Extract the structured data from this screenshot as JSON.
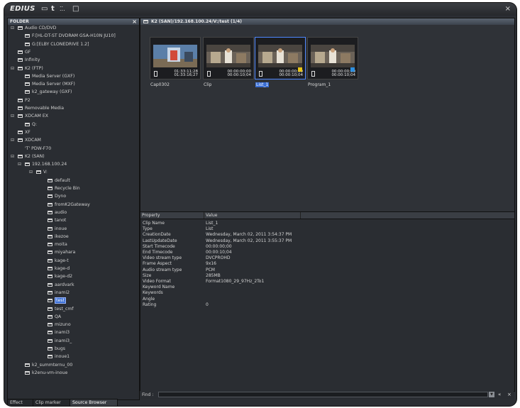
{
  "app": {
    "logo": "EDIUS"
  },
  "toolbar": {
    "icons": [
      "folder-icon",
      "text-icon",
      "grid-icon",
      "window-icon"
    ]
  },
  "folder_panel": {
    "title": "FOLDER",
    "close": "×",
    "tree": [
      {
        "label": "Audio CD/DVD",
        "level": 0,
        "exp": "−"
      },
      {
        "label": "F:[HL-DT-ST DVDRAM GSA-H10N JU10]",
        "level": 1,
        "exp": ""
      },
      {
        "label": "G:[ELBY CLONEDRIVE 1.2]",
        "level": 1,
        "exp": ""
      },
      {
        "label": "GF",
        "level": 0,
        "exp": ""
      },
      {
        "label": "Infinity",
        "level": 0,
        "exp": ""
      },
      {
        "label": "K2 (FTP)",
        "level": 0,
        "exp": "−"
      },
      {
        "label": "Media Server (GXF)",
        "level": 1,
        "exp": ""
      },
      {
        "label": "Media Server (MXF)",
        "level": 1,
        "exp": ""
      },
      {
        "label": "k2_gateway (GXF)",
        "level": 1,
        "exp": ""
      },
      {
        "label": "P2",
        "level": 0,
        "exp": ""
      },
      {
        "label": "Removable Media",
        "level": 0,
        "exp": ""
      },
      {
        "label": "XDCAM EX",
        "level": 0,
        "exp": "−"
      },
      {
        "label": "Q:",
        "level": 1,
        "exp": ""
      },
      {
        "label": "XF",
        "level": 0,
        "exp": ""
      },
      {
        "label": "XDCAM",
        "level": 0,
        "exp": "−"
      },
      {
        "label": "'T' PDW-F70",
        "level": 1,
        "exp": "",
        "plain": true
      },
      {
        "label": "K2 (SAN)",
        "level": 0,
        "exp": "−"
      },
      {
        "label": "192.168.100.24",
        "level": 1,
        "exp": "−"
      },
      {
        "label": "V:",
        "level": 2,
        "exp": "−"
      },
      {
        "label": "default",
        "level": 3,
        "exp": ""
      },
      {
        "label": "Recycle Bin",
        "level": 3,
        "exp": ""
      },
      {
        "label": "Dyno",
        "level": 3,
        "exp": ""
      },
      {
        "label": "fromK2Gateway",
        "level": 3,
        "exp": ""
      },
      {
        "label": "audio",
        "level": 3,
        "exp": ""
      },
      {
        "label": "tanot",
        "level": 3,
        "exp": ""
      },
      {
        "label": "inoue",
        "level": 3,
        "exp": ""
      },
      {
        "label": "ikezoe",
        "level": 3,
        "exp": ""
      },
      {
        "label": "moita",
        "level": 3,
        "exp": ""
      },
      {
        "label": "miyahara",
        "level": 3,
        "exp": ""
      },
      {
        "label": "kage-t",
        "level": 3,
        "exp": ""
      },
      {
        "label": "kage-d",
        "level": 3,
        "exp": ""
      },
      {
        "label": "kage-d2",
        "level": 3,
        "exp": ""
      },
      {
        "label": "aardvark",
        "level": 3,
        "exp": ""
      },
      {
        "label": "inami2",
        "level": 3,
        "exp": ""
      },
      {
        "label": "test",
        "level": 3,
        "exp": "",
        "selected": true
      },
      {
        "label": "test_cmf",
        "level": 3,
        "exp": ""
      },
      {
        "label": "QA",
        "level": 3,
        "exp": ""
      },
      {
        "label": "mizuno",
        "level": 3,
        "exp": ""
      },
      {
        "label": "inami3",
        "level": 3,
        "exp": ""
      },
      {
        "label": "inami3_",
        "level": 3,
        "exp": ""
      },
      {
        "label": "bugs",
        "level": 3,
        "exp": ""
      },
      {
        "label": "inoue1",
        "level": 3,
        "exp": ""
      },
      {
        "label": "k2_summternu_00",
        "level": 1,
        "exp": ""
      },
      {
        "label": "k2enu-vm-inoue",
        "level": 1,
        "exp": ""
      }
    ]
  },
  "bottom_tabs": [
    {
      "label": "Effect",
      "active": false
    },
    {
      "label": "Clip marker",
      "active": false
    },
    {
      "label": "Source Browser",
      "active": true
    }
  ],
  "browser": {
    "path": "K2 (SAN)/192.168.100.24/V:/test (1/4)",
    "clips": [
      {
        "label": "Cap0302",
        "timecode": "01:33:11;28\n01:33:16;27",
        "badge": "",
        "selected": false,
        "scene": "cap"
      },
      {
        "label": "Clip",
        "timecode": "00:00:00;00\n00:00:10;04",
        "badge": "",
        "selected": false,
        "scene": "room"
      },
      {
        "label": "List_1",
        "timecode": "00:00:00;00\n00:00:10;04",
        "badge": "#e6c419",
        "selected": true,
        "scene": "room"
      },
      {
        "label": "Program_1",
        "timecode": "00:00:00;00\n00:00:10;04",
        "badge": "#2d8fe0",
        "selected": false,
        "scene": "room"
      }
    ]
  },
  "properties": {
    "header": {
      "property": "Property",
      "value": "Value"
    },
    "rows": [
      {
        "k": "Clip Name",
        "v": "List_1"
      },
      {
        "k": "Type",
        "v": "List"
      },
      {
        "k": "CreationDate",
        "v": "Wednesday, March 02, 2011 3:54:37 PM"
      },
      {
        "k": "LastUpdateDate",
        "v": "Wednesday, March 02, 2011 3:55:37 PM"
      },
      {
        "k": "Start Timecode",
        "v": "00:00:00;00"
      },
      {
        "k": "End Timecode",
        "v": "00:00:10;04"
      },
      {
        "k": "Video stream type",
        "v": "DVCPROHD"
      },
      {
        "k": "Frame Aspect",
        "v": "9x16"
      },
      {
        "k": "Audio stream type",
        "v": "PCM"
      },
      {
        "k": "Size",
        "v": "285MB"
      },
      {
        "k": "Video Format",
        "v": "Format1080_29_97Hz_2To1"
      },
      {
        "k": "Keyword Name",
        "v": ""
      },
      {
        "k": "Keywords",
        "v": ""
      },
      {
        "k": "Angle",
        "v": ""
      },
      {
        "k": "Rating",
        "v": "0"
      }
    ]
  },
  "find": {
    "label": "Find :",
    "value": "",
    "nav": "«",
    "close": "×"
  }
}
